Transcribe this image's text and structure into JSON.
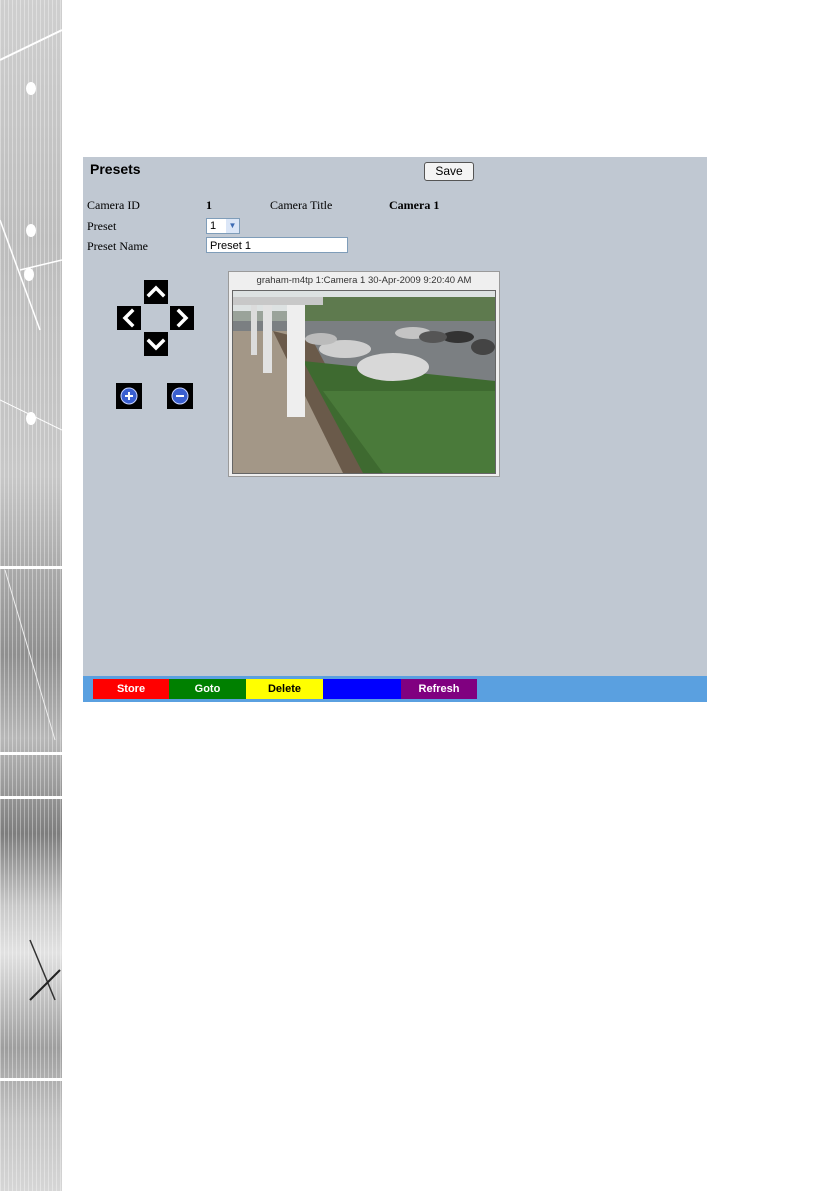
{
  "header": {
    "title": "Presets",
    "save_label": "Save"
  },
  "form": {
    "camera_id_label": "Camera ID",
    "camera_id_value": "1",
    "camera_title_label": "Camera Title",
    "camera_title_value": "Camera 1",
    "preset_label": "Preset",
    "preset_value": "1",
    "preset_name_label": "Preset Name",
    "preset_name_value": "Preset 1"
  },
  "viewer": {
    "caption": "graham-m4tp 1:Camera 1 30-Apr-2009 9:20:40 AM"
  },
  "footer": {
    "buttons": [
      {
        "label": "Store",
        "color": "#ff0000",
        "text_color": "#ffffff"
      },
      {
        "label": "Goto",
        "color": "#008000",
        "text_color": "#ffffff"
      },
      {
        "label": "Delete",
        "color": "#ffff00",
        "text_color": "#000000"
      },
      {
        "label": "",
        "color": "#0000ff",
        "text_color": "#ffffff"
      },
      {
        "label": "Refresh",
        "color": "#800080",
        "text_color": "#ffffff"
      }
    ],
    "bar_color": "#5aa0e0"
  },
  "colors": {
    "panel_bg": "#c0c8d2"
  },
  "icons": [
    "pan-up-icon",
    "pan-left-icon",
    "pan-right-icon",
    "pan-down-icon",
    "zoom-in-icon",
    "zoom-out-icon"
  ]
}
